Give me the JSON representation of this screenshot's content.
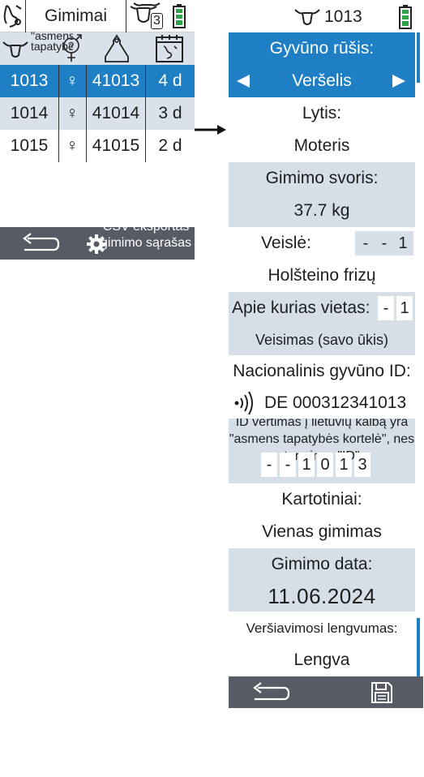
{
  "left_screen": {
    "header": {
      "title": "Gimimai",
      "cow_count": "3"
    },
    "table": {
      "header_text": "\"asmens tapatybės\"",
      "rows": [
        {
          "id": "1013",
          "sex": "♀",
          "ear_tag": "41013",
          "age": "4 d",
          "selected": true
        },
        {
          "id": "1014",
          "sex": "♀",
          "ear_tag": "41014",
          "age": "3 d",
          "selected": false
        },
        {
          "id": "1015",
          "sex": "♀",
          "ear_tag": "41015",
          "age": "2 d",
          "selected": false
        }
      ]
    },
    "footer": {
      "export_label": "CSV eksportas gimimo sąrašas"
    }
  },
  "right_screen": {
    "header": {
      "animal_id": "1013"
    },
    "species": {
      "label": "Gyvūno rūšis:",
      "value": "Veršelis"
    },
    "sex": {
      "label": "Lytis:",
      "value": "Moteris"
    },
    "birth_weight": {
      "label": "Gimimo svoris:",
      "value": "37.7 kg"
    },
    "breed": {
      "label": "Veislė:",
      "code_digits": [
        "-",
        "-",
        "1"
      ],
      "value": "Holšteino frizų"
    },
    "location": {
      "label": "Apie kurias vietas:",
      "code_digits": [
        "-",
        "1"
      ],
      "value": "Veisimas (savo ūkis)"
    },
    "national_id": {
      "label": "Nacionalinis gyvūno ID:",
      "value": "DE 000312341013"
    },
    "id_note": {
      "text": "ID vertimas į lietuvių kalbą yra \"asmens tapatybės kortelė\", nes terminas \"ID\"",
      "digits": [
        "-",
        "-",
        "1",
        "0",
        "1",
        "3"
      ]
    },
    "multiples": {
      "label": "Kartotiniai:",
      "value": "Vienas gimimas"
    },
    "birth_date": {
      "label": "Gimimo data:",
      "value": "11.06.2024"
    },
    "calving_ease": {
      "label": "Veršiavimosi lengvumas:",
      "value": "Lengva"
    }
  },
  "colors": {
    "accent": "#1f7fc4",
    "row_alt": "#dbe1ea",
    "footer": "#565b66",
    "battery": "#2fa24a"
  }
}
